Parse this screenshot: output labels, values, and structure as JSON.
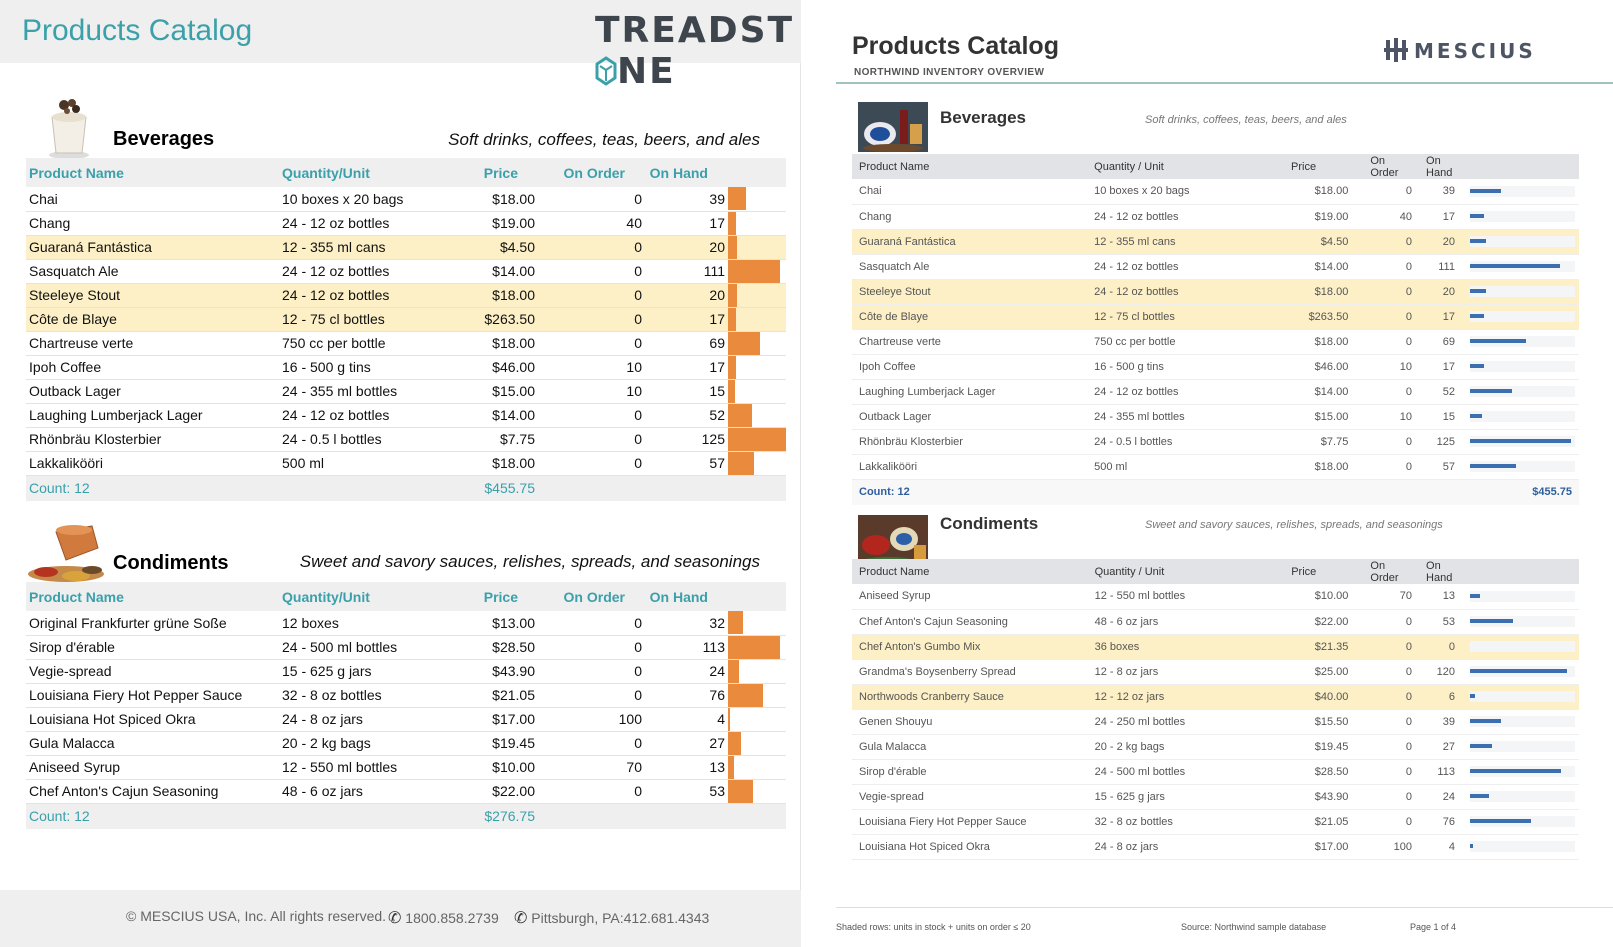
{
  "left": {
    "title": "Products Catalog",
    "logo": "TREADSTONE",
    "columns": [
      "Product Name",
      "Quantity/Unit",
      "Price",
      "On Order",
      "On Hand"
    ],
    "categories": [
      {
        "name": "Beverages",
        "description": "Soft drinks, coffees, teas, beers, and ales",
        "rows": [
          {
            "name": "Chai",
            "qty": "10 boxes x 20 bags",
            "price": "$18.00",
            "order": "0",
            "hand": "39",
            "hand_value": 39,
            "hl": false
          },
          {
            "name": "Chang",
            "qty": "24 - 12 oz bottles",
            "price": "$19.00",
            "order": "40",
            "hand": "17",
            "hand_value": 17,
            "hl": false
          },
          {
            "name": "Guaraná Fantástica",
            "qty": "12 - 355 ml cans",
            "price": "$4.50",
            "order": "0",
            "hand": "20",
            "hand_value": 20,
            "hl": true
          },
          {
            "name": "Sasquatch Ale",
            "qty": "24 - 12 oz bottles",
            "price": "$14.00",
            "order": "0",
            "hand": "111",
            "hand_value": 111,
            "hl": false
          },
          {
            "name": "Steeleye Stout",
            "qty": "24 - 12 oz bottles",
            "price": "$18.00",
            "order": "0",
            "hand": "20",
            "hand_value": 20,
            "hl": true
          },
          {
            "name": "Côte de Blaye",
            "qty": "12 - 75 cl bottles",
            "price": "$263.50",
            "order": "0",
            "hand": "17",
            "hand_value": 17,
            "hl": true
          },
          {
            "name": "Chartreuse verte",
            "qty": "750 cc per bottle",
            "price": "$18.00",
            "order": "0",
            "hand": "69",
            "hand_value": 69,
            "hl": false
          },
          {
            "name": "Ipoh Coffee",
            "qty": "16 - 500 g tins",
            "price": "$46.00",
            "order": "10",
            "hand": "17",
            "hand_value": 17,
            "hl": false
          },
          {
            "name": "Outback Lager",
            "qty": "24 - 355 ml bottles",
            "price": "$15.00",
            "order": "10",
            "hand": "15",
            "hand_value": 15,
            "hl": false
          },
          {
            "name": "Laughing Lumberjack Lager",
            "qty": "24 - 12 oz bottles",
            "price": "$14.00",
            "order": "0",
            "hand": "52",
            "hand_value": 52,
            "hl": false
          },
          {
            "name": "Rhönbräu Klosterbier",
            "qty": "24 - 0.5 l bottles",
            "price": "$7.75",
            "order": "0",
            "hand": "125",
            "hand_value": 125,
            "hl": false
          },
          {
            "name": "Lakkalikööri",
            "qty": "500 ml",
            "price": "$18.00",
            "order": "0",
            "hand": "57",
            "hand_value": 57,
            "hl": false
          }
        ],
        "count": "Count: 12",
        "total": "$455.75"
      },
      {
        "name": "Condiments",
        "description": "Sweet and savory sauces, relishes, spreads, and seasonings",
        "rows": [
          {
            "name": "Original Frankfurter grüne Soße",
            "qty": "12 boxes",
            "price": "$13.00",
            "order": "0",
            "hand": "32",
            "hand_value": 32,
            "hl": false
          },
          {
            "name": "Sirop d'érable",
            "qty": "24 - 500 ml bottles",
            "price": "$28.50",
            "order": "0",
            "hand": "113",
            "hand_value": 113,
            "hl": false
          },
          {
            "name": "Vegie-spread",
            "qty": "15 - 625 g jars",
            "price": "$43.90",
            "order": "0",
            "hand": "24",
            "hand_value": 24,
            "hl": false
          },
          {
            "name": "Louisiana Fiery Hot Pepper Sauce",
            "qty": "32 - 8 oz bottles",
            "price": "$21.05",
            "order": "0",
            "hand": "76",
            "hand_value": 76,
            "hl": false
          },
          {
            "name": "Louisiana Hot Spiced Okra",
            "qty": "24 - 8 oz jars",
            "price": "$17.00",
            "order": "100",
            "hand": "4",
            "hand_value": 4,
            "hl": false
          },
          {
            "name": "Gula Malacca",
            "qty": "20 - 2 kg bags",
            "price": "$19.45",
            "order": "0",
            "hand": "27",
            "hand_value": 27,
            "hl": false
          },
          {
            "name": "Aniseed Syrup",
            "qty": "12 - 550 ml bottles",
            "price": "$10.00",
            "order": "70",
            "hand": "13",
            "hand_value": 13,
            "hl": false
          },
          {
            "name": "Chef Anton's Cajun Seasoning",
            "qty": "48 - 6 oz jars",
            "price": "$22.00",
            "order": "0",
            "hand": "53",
            "hand_value": 53,
            "hl": false
          }
        ],
        "count": "Count: 12",
        "total": "$276.75"
      }
    ],
    "footer": {
      "copyright": "© MESCIUS USA, Inc. All rights reserved.",
      "phone": "1800.858.2739",
      "location": "Pittsburgh, PA:412.681.4343"
    }
  },
  "right": {
    "title": "Products Catalog",
    "subtitle": "NORTHWIND INVENTORY OVERVIEW",
    "logo": "MESCIUS",
    "columns": [
      "Product Name",
      "Quantity / Unit",
      "Price",
      "On Order",
      "On Hand"
    ],
    "categories": [
      {
        "name": "Beverages",
        "description": "Soft drinks, coffees, teas, beers, and ales",
        "rows": [
          {
            "name": "Chai",
            "qty": "10 boxes x 20 bags",
            "price": "$18.00",
            "order": "0",
            "hand": "39",
            "hand_value": 39,
            "hl": false
          },
          {
            "name": "Chang",
            "qty": "24 - 12 oz bottles",
            "price": "$19.00",
            "order": "40",
            "hand": "17",
            "hand_value": 17,
            "hl": false
          },
          {
            "name": "Guaraná Fantástica",
            "qty": "12 - 355 ml cans",
            "price": "$4.50",
            "order": "0",
            "hand": "20",
            "hand_value": 20,
            "hl": true
          },
          {
            "name": "Sasquatch Ale",
            "qty": "24 - 12 oz bottles",
            "price": "$14.00",
            "order": "0",
            "hand": "111",
            "hand_value": 111,
            "hl": false
          },
          {
            "name": "Steeleye Stout",
            "qty": "24 - 12 oz bottles",
            "price": "$18.00",
            "order": "0",
            "hand": "20",
            "hand_value": 20,
            "hl": true
          },
          {
            "name": "Côte de Blaye",
            "qty": "12 - 75 cl bottles",
            "price": "$263.50",
            "order": "0",
            "hand": "17",
            "hand_value": 17,
            "hl": true
          },
          {
            "name": "Chartreuse verte",
            "qty": "750 cc per bottle",
            "price": "$18.00",
            "order": "0",
            "hand": "69",
            "hand_value": 69,
            "hl": false
          },
          {
            "name": "Ipoh Coffee",
            "qty": "16 - 500 g tins",
            "price": "$46.00",
            "order": "10",
            "hand": "17",
            "hand_value": 17,
            "hl": false
          },
          {
            "name": "Laughing Lumberjack Lager",
            "qty": "24 - 12 oz bottles",
            "price": "$14.00",
            "order": "0",
            "hand": "52",
            "hand_value": 52,
            "hl": false
          },
          {
            "name": "Outback Lager",
            "qty": "24 - 355 ml bottles",
            "price": "$15.00",
            "order": "10",
            "hand": "15",
            "hand_value": 15,
            "hl": false
          },
          {
            "name": "Rhönbräu Klosterbier",
            "qty": "24 - 0.5 l bottles",
            "price": "$7.75",
            "order": "0",
            "hand": "125",
            "hand_value": 125,
            "hl": false
          },
          {
            "name": "Lakkalikööri",
            "qty": "500 ml",
            "price": "$18.00",
            "order": "0",
            "hand": "57",
            "hand_value": 57,
            "hl": false
          }
        ],
        "count": "Count: 12",
        "total": "$455.75"
      },
      {
        "name": "Condiments",
        "description": "Sweet and savory sauces, relishes, spreads, and seasonings",
        "rows": [
          {
            "name": "Aniseed Syrup",
            "qty": "12 - 550 ml bottles",
            "price": "$10.00",
            "order": "70",
            "hand": "13",
            "hand_value": 13,
            "hl": false
          },
          {
            "name": "Chef Anton's Cajun Seasoning",
            "qty": "48 - 6 oz jars",
            "price": "$22.00",
            "order": "0",
            "hand": "53",
            "hand_value": 53,
            "hl": false
          },
          {
            "name": "Chef Anton's Gumbo Mix",
            "qty": "36 boxes",
            "price": "$21.35",
            "order": "0",
            "hand": "0",
            "hand_value": 0,
            "hl": true
          },
          {
            "name": "Grandma's Boysenberry Spread",
            "qty": "12 - 8 oz jars",
            "price": "$25.00",
            "order": "0",
            "hand": "120",
            "hand_value": 120,
            "hl": false
          },
          {
            "name": "Northwoods Cranberry Sauce",
            "qty": "12 - 12 oz jars",
            "price": "$40.00",
            "order": "0",
            "hand": "6",
            "hand_value": 6,
            "hl": true
          },
          {
            "name": "Genen Shouyu",
            "qty": "24 - 250 ml bottles",
            "price": "$15.50",
            "order": "0",
            "hand": "39",
            "hand_value": 39,
            "hl": false
          },
          {
            "name": "Gula Malacca",
            "qty": "20 - 2 kg bags",
            "price": "$19.45",
            "order": "0",
            "hand": "27",
            "hand_value": 27,
            "hl": false
          },
          {
            "name": "Sirop d'érable",
            "qty": "24 - 500 ml bottles",
            "price": "$28.50",
            "order": "0",
            "hand": "113",
            "hand_value": 113,
            "hl": false
          },
          {
            "name": "Vegie-spread",
            "qty": "15 - 625 g jars",
            "price": "$43.90",
            "order": "0",
            "hand": "24",
            "hand_value": 24,
            "hl": false
          },
          {
            "name": "Louisiana Fiery Hot Pepper Sauce",
            "qty": "32 - 8 oz bottles",
            "price": "$21.05",
            "order": "0",
            "hand": "76",
            "hand_value": 76,
            "hl": false
          },
          {
            "name": "Louisiana Hot Spiced Okra",
            "qty": "24 - 8 oz jars",
            "price": "$17.00",
            "order": "100",
            "hand": "4",
            "hand_value": 4,
            "hl": false
          }
        ]
      }
    ],
    "footer": {
      "note": "Shaded rows: units in stock + units on order ≤ 20",
      "source": "Source: Northwind sample database",
      "page": "Page 1 of 4"
    }
  }
}
